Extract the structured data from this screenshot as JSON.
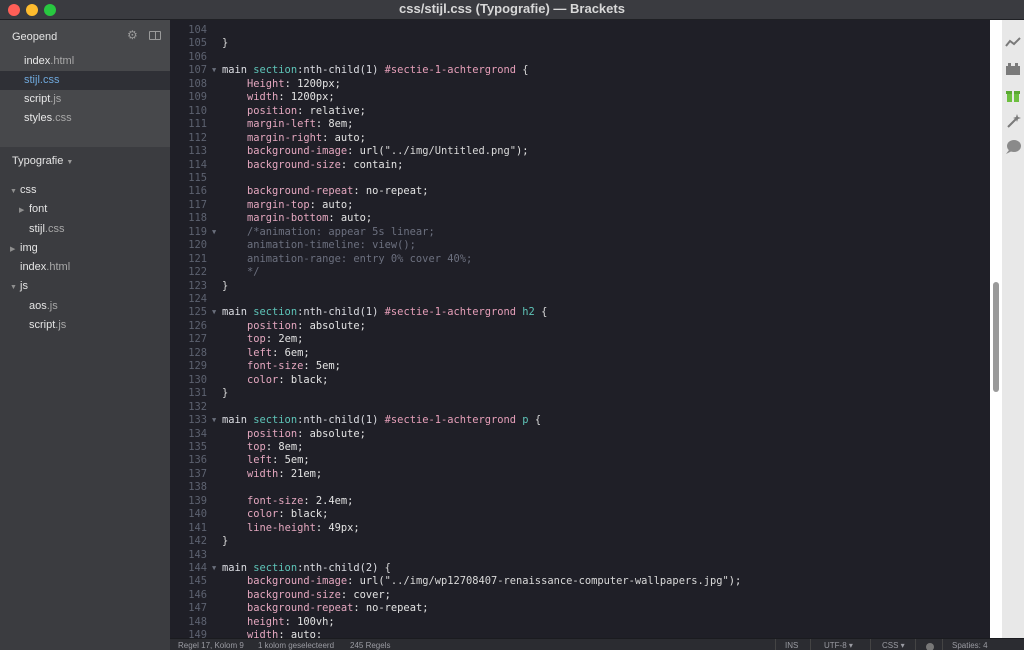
{
  "window": {
    "title": "css/stijl.css (Typografie) — Brackets"
  },
  "sidebar": {
    "open_header": "Geopend",
    "open_files": [
      {
        "name": "index",
        "ext": ".html",
        "active": false
      },
      {
        "name": "stijl",
        "ext": ".css",
        "active": true
      },
      {
        "name": "script",
        "ext": ".js",
        "active": false
      },
      {
        "name": "styles",
        "ext": ".css",
        "active": false
      }
    ],
    "project_name": "Typografie",
    "tree": [
      {
        "name": "css",
        "ext": "",
        "type": "folder",
        "expanded": true,
        "depth": 0
      },
      {
        "name": "font",
        "ext": "",
        "type": "folder",
        "expanded": false,
        "depth": 1
      },
      {
        "name": "stijl",
        "ext": ".css",
        "type": "file",
        "depth": 1
      },
      {
        "name": "img",
        "ext": "",
        "type": "folder",
        "expanded": false,
        "depth": 0
      },
      {
        "name": "index",
        "ext": ".html",
        "type": "file",
        "depth": 0
      },
      {
        "name": "js",
        "ext": "",
        "type": "folder",
        "expanded": true,
        "depth": 0
      },
      {
        "name": "aos",
        "ext": ".js",
        "type": "file",
        "depth": 1
      },
      {
        "name": "script",
        "ext": ".js",
        "type": "file",
        "depth": 1
      }
    ]
  },
  "editor": {
    "lines": [
      {
        "n": "104",
        "fold": "",
        "parts": []
      },
      {
        "n": "105",
        "fold": "",
        "parts": [
          [
            "brace",
            "}"
          ]
        ]
      },
      {
        "n": "106",
        "fold": "",
        "parts": []
      },
      {
        "n": "107",
        "fold": "▼",
        "parts": [
          [
            "tag",
            "main "
          ],
          [
            "kw",
            "section"
          ],
          [
            "tag",
            ":nth-child(1) "
          ],
          [
            "cls",
            "#sectie-1-achtergrond"
          ],
          [
            "brace",
            " {"
          ]
        ]
      },
      {
        "n": "108",
        "fold": "",
        "parts": [
          [
            "val",
            "    "
          ],
          [
            "prop",
            "Height"
          ],
          [
            "val",
            ": 1200px;"
          ]
        ]
      },
      {
        "n": "109",
        "fold": "",
        "parts": [
          [
            "val",
            "    "
          ],
          [
            "prop",
            "width"
          ],
          [
            "val",
            ": 1200px;"
          ]
        ]
      },
      {
        "n": "110",
        "fold": "",
        "parts": [
          [
            "val",
            "    "
          ],
          [
            "prop",
            "position"
          ],
          [
            "val",
            ": relative;"
          ]
        ]
      },
      {
        "n": "111",
        "fold": "",
        "parts": [
          [
            "val",
            "    "
          ],
          [
            "prop",
            "margin-left"
          ],
          [
            "val",
            ": 8em;"
          ]
        ]
      },
      {
        "n": "112",
        "fold": "",
        "parts": [
          [
            "val",
            "    "
          ],
          [
            "prop",
            "margin-right"
          ],
          [
            "val",
            ": auto;"
          ]
        ]
      },
      {
        "n": "113",
        "fold": "",
        "parts": [
          [
            "val",
            "    "
          ],
          [
            "prop",
            "background-image"
          ],
          [
            "val",
            ": url("
          ],
          [
            "str",
            "\"../img/Untitled.png\""
          ],
          [
            "val",
            ");"
          ]
        ]
      },
      {
        "n": "114",
        "fold": "",
        "parts": [
          [
            "val",
            "    "
          ],
          [
            "prop",
            "background-size"
          ],
          [
            "val",
            ": contain;"
          ]
        ]
      },
      {
        "n": "115",
        "fold": "",
        "parts": []
      },
      {
        "n": "116",
        "fold": "",
        "parts": [
          [
            "val",
            "    "
          ],
          [
            "prop",
            "background-repeat"
          ],
          [
            "val",
            ": no-repeat;"
          ]
        ]
      },
      {
        "n": "117",
        "fold": "",
        "parts": [
          [
            "val",
            "    "
          ],
          [
            "prop",
            "margin-top"
          ],
          [
            "val",
            ": auto;"
          ]
        ]
      },
      {
        "n": "118",
        "fold": "",
        "parts": [
          [
            "val",
            "    "
          ],
          [
            "prop",
            "margin-bottom"
          ],
          [
            "val",
            ": auto;"
          ]
        ]
      },
      {
        "n": "119",
        "fold": "▼",
        "parts": [
          [
            "com",
            "    /*animation: appear 5s linear;"
          ]
        ]
      },
      {
        "n": "120",
        "fold": "",
        "parts": [
          [
            "com",
            "    animation-timeline: view();"
          ]
        ]
      },
      {
        "n": "121",
        "fold": "",
        "parts": [
          [
            "com",
            "    animation-range: entry 0% cover 40%;"
          ]
        ]
      },
      {
        "n": "122",
        "fold": "",
        "parts": [
          [
            "com",
            "    */"
          ]
        ]
      },
      {
        "n": "123",
        "fold": "",
        "parts": [
          [
            "brace",
            "}"
          ]
        ]
      },
      {
        "n": "124",
        "fold": "",
        "parts": []
      },
      {
        "n": "125",
        "fold": "▼",
        "parts": [
          [
            "tag",
            "main "
          ],
          [
            "kw",
            "section"
          ],
          [
            "tag",
            ":nth-child(1) "
          ],
          [
            "cls",
            "#sectie-1-achtergrond"
          ],
          [
            "kw",
            " h2"
          ],
          [
            "brace",
            " {"
          ]
        ]
      },
      {
        "n": "126",
        "fold": "",
        "parts": [
          [
            "val",
            "    "
          ],
          [
            "prop",
            "position"
          ],
          [
            "val",
            ": absolute;"
          ]
        ]
      },
      {
        "n": "127",
        "fold": "",
        "parts": [
          [
            "val",
            "    "
          ],
          [
            "prop",
            "top"
          ],
          [
            "val",
            ": 2em;"
          ]
        ]
      },
      {
        "n": "128",
        "fold": "",
        "parts": [
          [
            "val",
            "    "
          ],
          [
            "prop",
            "left"
          ],
          [
            "val",
            ": 6em;"
          ]
        ]
      },
      {
        "n": "129",
        "fold": "",
        "parts": [
          [
            "val",
            "    "
          ],
          [
            "prop",
            "font-size"
          ],
          [
            "val",
            ": 5em;"
          ]
        ]
      },
      {
        "n": "130",
        "fold": "",
        "parts": [
          [
            "val",
            "    "
          ],
          [
            "prop",
            "color"
          ],
          [
            "val",
            ": black;"
          ]
        ]
      },
      {
        "n": "131",
        "fold": "",
        "parts": [
          [
            "brace",
            "}"
          ]
        ]
      },
      {
        "n": "132",
        "fold": "",
        "parts": []
      },
      {
        "n": "133",
        "fold": "▼",
        "parts": [
          [
            "tag",
            "main "
          ],
          [
            "kw",
            "section"
          ],
          [
            "tag",
            ":nth-child(1) "
          ],
          [
            "cls",
            "#sectie-1-achtergrond"
          ],
          [
            "kw",
            " p"
          ],
          [
            "brace",
            " {"
          ]
        ]
      },
      {
        "n": "134",
        "fold": "",
        "parts": [
          [
            "val",
            "    "
          ],
          [
            "prop",
            "position"
          ],
          [
            "val",
            ": absolute;"
          ]
        ]
      },
      {
        "n": "135",
        "fold": "",
        "parts": [
          [
            "val",
            "    "
          ],
          [
            "prop",
            "top"
          ],
          [
            "val",
            ": 8em;"
          ]
        ]
      },
      {
        "n": "136",
        "fold": "",
        "parts": [
          [
            "val",
            "    "
          ],
          [
            "prop",
            "left"
          ],
          [
            "val",
            ": 5em;"
          ]
        ]
      },
      {
        "n": "137",
        "fold": "",
        "parts": [
          [
            "val",
            "    "
          ],
          [
            "prop",
            "width"
          ],
          [
            "val",
            ": 21em;"
          ]
        ]
      },
      {
        "n": "138",
        "fold": "",
        "parts": []
      },
      {
        "n": "139",
        "fold": "",
        "parts": [
          [
            "val",
            "    "
          ],
          [
            "prop",
            "font-size"
          ],
          [
            "val",
            ": 2.4em;"
          ]
        ]
      },
      {
        "n": "140",
        "fold": "",
        "parts": [
          [
            "val",
            "    "
          ],
          [
            "prop",
            "color"
          ],
          [
            "val",
            ": black;"
          ]
        ]
      },
      {
        "n": "141",
        "fold": "",
        "parts": [
          [
            "val",
            "    "
          ],
          [
            "prop",
            "line-height"
          ],
          [
            "val",
            ": 49px;"
          ]
        ]
      },
      {
        "n": "142",
        "fold": "",
        "parts": [
          [
            "brace",
            "}"
          ]
        ]
      },
      {
        "n": "143",
        "fold": "",
        "parts": []
      },
      {
        "n": "144",
        "fold": "▼",
        "parts": [
          [
            "tag",
            "main "
          ],
          [
            "kw",
            "section"
          ],
          [
            "tag",
            ":nth-child(2)"
          ],
          [
            "brace",
            " {"
          ]
        ]
      },
      {
        "n": "145",
        "fold": "",
        "parts": [
          [
            "val",
            "    "
          ],
          [
            "prop",
            "background-image"
          ],
          [
            "val",
            ": url("
          ],
          [
            "str",
            "\"../img/wp12708407-renaissance-computer-wallpapers.jpg\""
          ],
          [
            "val",
            ");"
          ]
        ]
      },
      {
        "n": "146",
        "fold": "",
        "parts": [
          [
            "val",
            "    "
          ],
          [
            "prop",
            "background-size"
          ],
          [
            "val",
            ": cover;"
          ]
        ]
      },
      {
        "n": "147",
        "fold": "",
        "parts": [
          [
            "val",
            "    "
          ],
          [
            "prop",
            "background-repeat"
          ],
          [
            "val",
            ": no-repeat;"
          ]
        ]
      },
      {
        "n": "148",
        "fold": "",
        "parts": [
          [
            "val",
            "    "
          ],
          [
            "prop",
            "height"
          ],
          [
            "val",
            ": 100vh;"
          ]
        ]
      },
      {
        "n": "149",
        "fold": "",
        "parts": [
          [
            "val",
            "    "
          ],
          [
            "prop",
            "width"
          ],
          [
            "val",
            ": auto;"
          ]
        ]
      }
    ]
  },
  "status": {
    "position": "Regel 17, Kolom 9",
    "selection": "1 kolom geselecteerd",
    "lines": "245 Regels",
    "mode": "INS",
    "encoding": "UTF-8",
    "language": "CSS",
    "spaces": "Spaties: 4"
  },
  "toolbar_icons": [
    "live-preview-icon",
    "extension-manager-icon",
    "extension-gift-icon",
    "beautify-wand-icon",
    "lint-bubble-icon"
  ],
  "colors": {
    "editor_bg": "#1f1f27",
    "sidebar_bg": "#47484b",
    "active_file": "#6fa8dc",
    "selector_keyword": "#5ec4b8",
    "id_selector": "#e69fb9",
    "property": "#e4a7bf"
  }
}
